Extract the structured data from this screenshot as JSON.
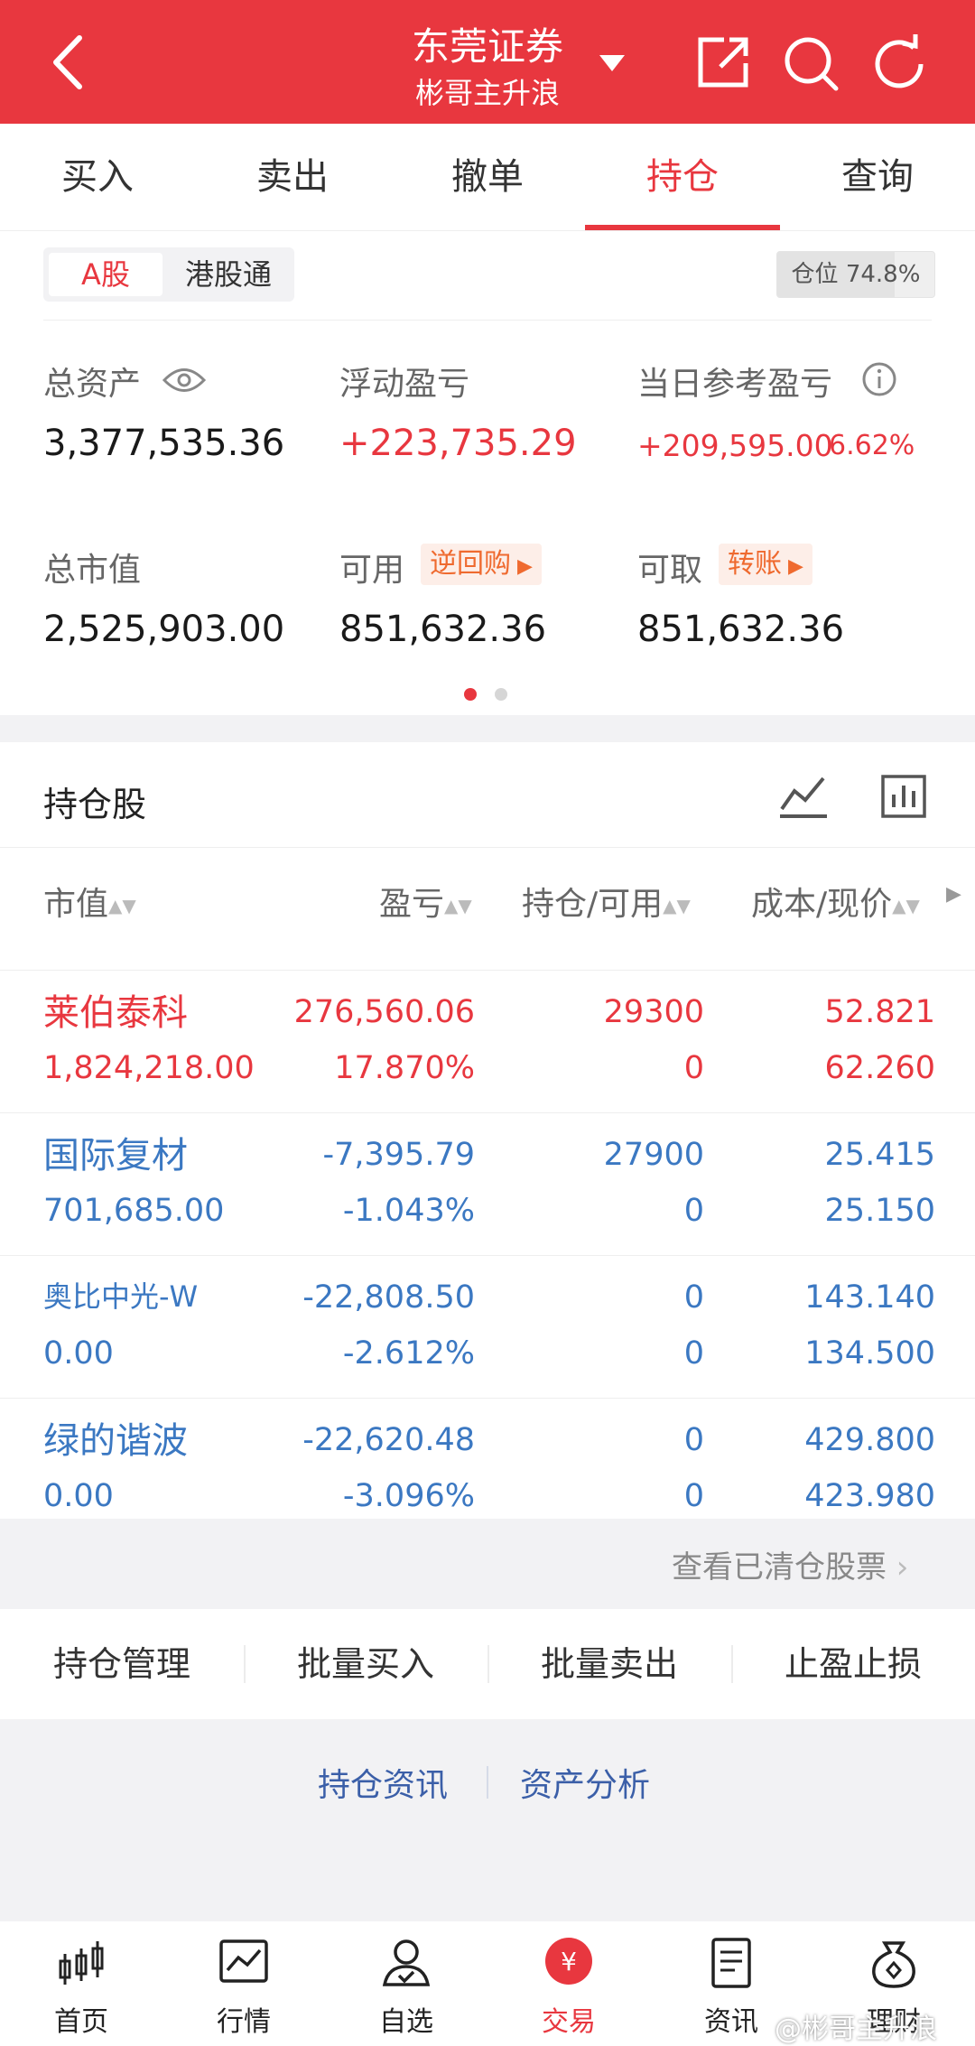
{
  "header": {
    "broker": "东莞证券",
    "account": "彬哥主升浪"
  },
  "tabs": [
    "买入",
    "卖出",
    "撤单",
    "持仓",
    "查询"
  ],
  "market_tabs": [
    "A股",
    "港股通"
  ],
  "position_ratio": {
    "label": "仓位",
    "value": "74.8%",
    "fraction": 0.748
  },
  "summary": {
    "total_assets_label": "总资产",
    "total_assets": "3,377,535.36",
    "float_pl_label": "浮动盈亏",
    "float_pl": "+223,735.29",
    "daily_pl_label": "当日参考盈亏",
    "daily_pl": "+209,595.00",
    "daily_pl_pct": "6.62%",
    "market_value_label": "总市值",
    "market_value": "2,525,903.00",
    "available_label": "可用",
    "available_tag": "逆回购",
    "available": "851,632.36",
    "withdrawable_label": "可取",
    "withdrawable_tag": "转账",
    "withdrawable": "851,632.36"
  },
  "holdings": {
    "title": "持仓股",
    "columns": [
      "市值",
      "盈亏",
      "持仓/可用",
      "成本/现价"
    ],
    "rows": [
      {
        "name": "莱伯泰科",
        "market_value": "1,824,218.00",
        "pl": "276,560.06",
        "pl_pct": "17.870%",
        "position": "29300",
        "available": "0",
        "cost": "52.821",
        "price": "62.260",
        "color": "#e8373f"
      },
      {
        "name": "国际复材",
        "market_value": "701,685.00",
        "pl": "-7,395.79",
        "pl_pct": "-1.043%",
        "position": "27900",
        "available": "0",
        "cost": "25.415",
        "price": "25.150",
        "color": "#3b78c2"
      },
      {
        "name": "奥比中光-W",
        "market_value": "0.00",
        "pl": "-22,808.50",
        "pl_pct": "-2.612%",
        "position": "0",
        "available": "0",
        "cost": "143.140",
        "price": "134.500",
        "color": "#3b78c2"
      },
      {
        "name": "绿的谐波",
        "market_value": "0.00",
        "pl": "-22,620.48",
        "pl_pct": "-3.096%",
        "position": "0",
        "available": "0",
        "cost": "429.800",
        "price": "423.980",
        "color": "#3b78c2"
      }
    ],
    "cleared_link": "查看已清仓股票"
  },
  "actions": [
    "持仓管理",
    "批量买入",
    "批量卖出",
    "止盈止损"
  ],
  "links": [
    "持仓资讯",
    "资产分析"
  ],
  "nav": [
    "首页",
    "行情",
    "自选",
    "交易",
    "资讯",
    "理财"
  ],
  "watermark": "@彬哥主升浪",
  "colors": {
    "brand": "#e8373f",
    "up": "#e8373f",
    "down": "#3b78c2",
    "tag": "#ef6a2f"
  }
}
